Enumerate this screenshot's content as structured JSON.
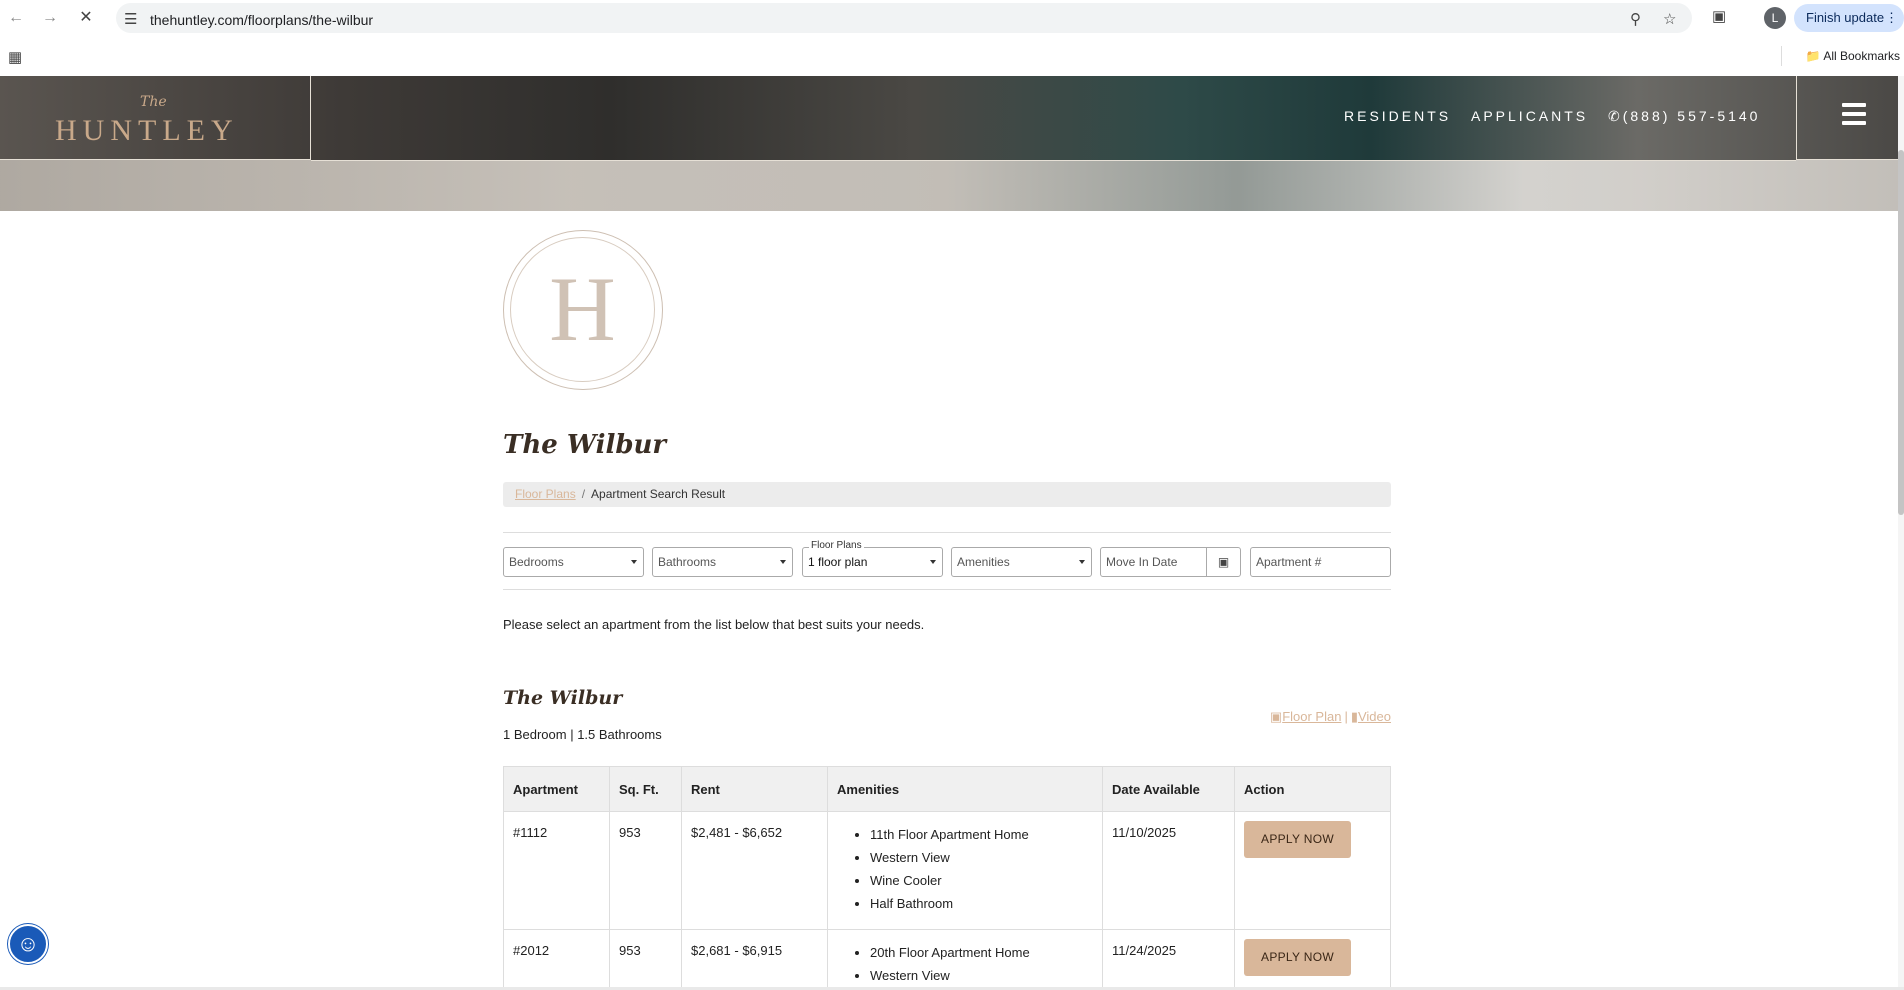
{
  "browser": {
    "url": "thehuntley.com/floorplans/the-wilbur",
    "finish_update": "Finish update",
    "profile_initial": "L",
    "all_bookmarks": "All Bookmarks"
  },
  "header": {
    "logo_the": "The",
    "logo_name": "HUNTLEY",
    "nav": {
      "residents": "RESIDENTS",
      "applicants": "APPLICANTS",
      "phone": "(888) 557-5140"
    }
  },
  "page": {
    "logo_letter": "H",
    "title": "The Wilbur",
    "breadcrumb": {
      "link": "Floor Plans",
      "separator": "/",
      "current": "Apartment Search Result"
    },
    "filters": {
      "bedrooms": "Bedrooms",
      "bathrooms": "Bathrooms",
      "floor_plans_label": "Floor Plans",
      "floor_plans_value": "1 floor plan",
      "amenities": "Amenities",
      "move_in_placeholder": "Move In Date",
      "apartment_placeholder": "Apartment #"
    },
    "instruction": "Please select an apartment from the list below that best suits your needs."
  },
  "plan": {
    "title": "The Wilbur",
    "subtitle": "1 Bedroom | 1.5 Bathrooms",
    "floor_plan_link": "Floor Plan",
    "separator": "|",
    "video_link": "Video"
  },
  "table": {
    "headers": [
      "Apartment",
      "Sq. Ft.",
      "Rent",
      "Amenities",
      "Date Available",
      "Action"
    ],
    "rows": [
      {
        "apartment": "#1112",
        "sqft": "953",
        "rent": "$2,481 - $6,652",
        "amenities": [
          "11th Floor Apartment Home",
          "Western View",
          "Wine Cooler",
          "Half Bathroom"
        ],
        "date": "11/10/2025",
        "action": "APPLY NOW"
      },
      {
        "apartment": "#2012",
        "sqft": "953",
        "rent": "$2,681 - $6,915",
        "amenities": [
          "20th Floor Apartment Home",
          "Western View"
        ],
        "date": "11/24/2025",
        "action": "APPLY NOW"
      }
    ]
  },
  "colors": {
    "accent": "#d9b79a",
    "accessibility": "#1a5ab8"
  }
}
